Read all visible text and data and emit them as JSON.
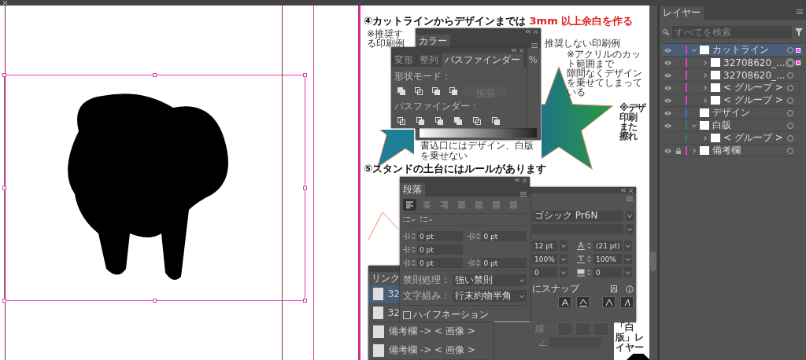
{
  "document": {
    "heading_1": {
      "text": "④カットラインからデザインまでは ",
      "highlight": "3mm 以上余白を作る"
    },
    "note_recommended": "※推奨する印刷例",
    "note_not_recommended": "推奨しない印刷例",
    "note_acrylic": [
      "※アクリルのカット範囲まで",
      "隙間なくデザインを乗せてしまっている"
    ],
    "note_side": [
      "※デザ",
      "印刷",
      "また",
      "擦れ"
    ],
    "note_bottom": "書込口にはデザイン、白版を乗せない",
    "heading_2": "⑤スタンドの土台にはルールがあります",
    "white_plate_label": "「白版」レイヤー"
  },
  "color_panel": {
    "tab": "カラー",
    "unit": "%"
  },
  "pathfinder_panel": {
    "tabs": [
      {
        "label": "変形",
        "selected": false
      },
      {
        "label": "整列",
        "selected": false
      },
      {
        "label": "パスファインダー",
        "selected": true
      }
    ],
    "shape_modes_label": "形状モード：",
    "expand_button": {
      "label": "拡張",
      "disabled": true
    },
    "pathfinders_label": "パスファインダー："
  },
  "character_panel": {
    "font_family": "ゴシック Pr6N",
    "size": "12 pt",
    "leading": "(21 pt)",
    "vertical_scale": "100%",
    "horizontal_scale": "100%",
    "kerning": "0",
    "tracking": "0",
    "snap_label": "にスナップ"
  },
  "stroke_panel": {
    "label": "線："
  },
  "paragraph_panel": {
    "tab": "段落",
    "alignments": [
      {
        "selected": true
      },
      {
        "selected": false
      },
      {
        "selected": false
      },
      {
        "selected": false
      },
      {
        "selected": false
      },
      {
        "selected": false
      },
      {
        "selected": false
      }
    ],
    "fields": [
      {
        "kind": "left-indent",
        "value": "0 pt"
      },
      {
        "kind": "right-indent",
        "value": "0 pt"
      },
      {
        "kind": "first-line-indent",
        "value": "0 pt"
      },
      {
        "kind": "space-before",
        "value": "0 pt"
      },
      {
        "kind": "space-after",
        "value": "0 pt"
      }
    ],
    "kinsoku": {
      "label": "禁則処理：",
      "value": "強い禁則"
    },
    "mojikumi": {
      "label": "文字組み：",
      "value": "行末約物半角"
    },
    "hyphenation": {
      "label": "ハイフネーション",
      "checked": false
    }
  },
  "links_panel": {
    "tab": "リンク",
    "items": [
      {
        "name": "32",
        "selected": true
      },
      {
        "name": "32",
        "selected": false
      },
      {
        "name": "備考欄 -> < 画像 >",
        "selected": false
      },
      {
        "name": "備考欄 -> < 画像 >",
        "selected": false
      }
    ]
  },
  "layers_panel": {
    "tab": "レイヤー",
    "search": {
      "placeholder": "すべてを検索"
    },
    "layers": [
      {
        "name": "カットライン",
        "color": "#e040d0",
        "visible": true,
        "locked": false,
        "selected": true,
        "has_selection": true,
        "targeted": false,
        "expanded": true,
        "children": [
          {
            "name": "32708620_...",
            "visible": true,
            "locked": false,
            "selected": false,
            "has_selection": true,
            "targeted": true,
            "expanded": false
          },
          {
            "name": "32708620_...",
            "visible": true,
            "locked": false,
            "selected": false,
            "has_selection": false,
            "targeted": false,
            "expanded": false
          },
          {
            "name": "< グループ >",
            "visible": true,
            "locked": false,
            "selected": false,
            "has_selection": false,
            "targeted": false,
            "expanded": false
          },
          {
            "name": "< グループ >",
            "visible": true,
            "locked": false,
            "selected": false,
            "has_selection": false,
            "targeted": false,
            "expanded": false
          }
        ]
      },
      {
        "name": "デザイン",
        "color": "#3a6fd8",
        "visible": true,
        "locked": false,
        "selected": false,
        "has_selection": false,
        "targeted": false
      },
      {
        "name": "白版",
        "color": "#1a8a80",
        "visible": true,
        "locked": false,
        "selected": false,
        "has_selection": false,
        "targeted": false,
        "expanded": true,
        "children": [
          {
            "name": "< グループ >",
            "visible": false,
            "locked": false,
            "selected": false,
            "has_selection": false,
            "targeted": false,
            "expanded": false
          }
        ]
      },
      {
        "name": "備考欄",
        "color": "#e040d0",
        "visible": true,
        "locked": true,
        "selected": false,
        "has_selection": false,
        "targeted": false,
        "expanded": false
      }
    ]
  }
}
